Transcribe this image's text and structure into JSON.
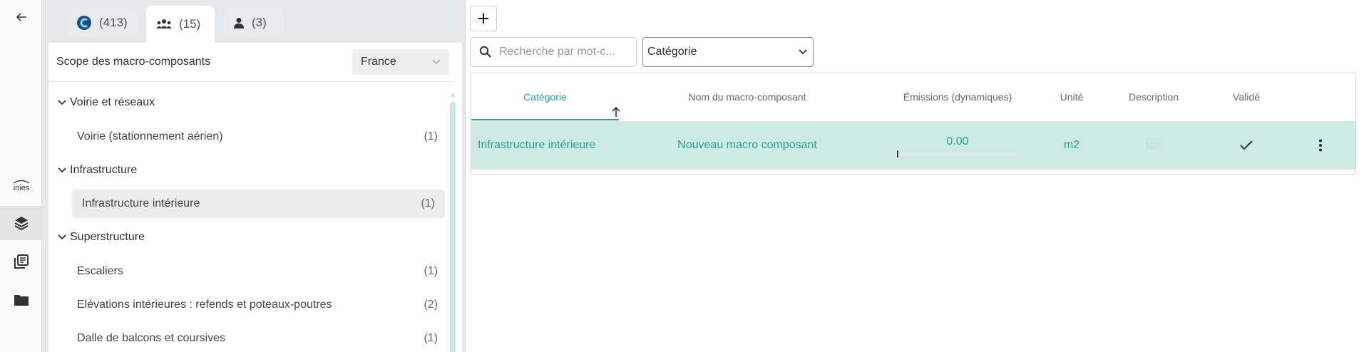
{
  "rail": {
    "icons": [
      "back-arrow-icon",
      "inies-logo",
      "layers-icon",
      "library-icon",
      "folder-icon"
    ],
    "inies_label": "inies"
  },
  "tabs": [
    {
      "name": "tab-components",
      "icon": "brand-logo-icon",
      "count": "(413)"
    },
    {
      "name": "tab-group",
      "icon": "group-icon",
      "count": "(15)"
    },
    {
      "name": "tab-user",
      "icon": "user-icon",
      "count": "(3)"
    }
  ],
  "scope": {
    "label": "Scope des macro-composants",
    "value": "France"
  },
  "tree": {
    "groups": [
      {
        "label": "Voirie et réseaux",
        "items": [
          {
            "label": "Voirie (stationnement aérien)",
            "count": "(1)"
          }
        ]
      },
      {
        "label": "Infrastructure",
        "items": [
          {
            "label": "Infrastructure intérieure",
            "count": "(1)"
          }
        ]
      },
      {
        "label": "Superstructure",
        "items": [
          {
            "label": "Escaliers",
            "count": "(1)"
          },
          {
            "label": "Elévations intérieures : refends et poteaux-poutres",
            "count": "(2)"
          },
          {
            "label": "Dalle de balcons et coursives",
            "count": "(1)"
          }
        ]
      }
    ]
  },
  "toolbar": {
    "search_placeholder": "Recherche par mot-c...",
    "category_select": "Catégorie"
  },
  "table": {
    "headers": [
      "Catégorie",
      "Nom du macro-composant",
      "Émissions (dynamiques)",
      "Unité",
      "Description",
      "Validé"
    ],
    "rows": [
      {
        "category": "Infrastructure intérieure",
        "name": "Nouveau macro composant",
        "emissions": "0.00",
        "unit": "m2",
        "description": "N/A",
        "validated": true
      }
    ]
  },
  "colors": {
    "accent": "#26a48d",
    "row_selected": "#cdebe4"
  }
}
